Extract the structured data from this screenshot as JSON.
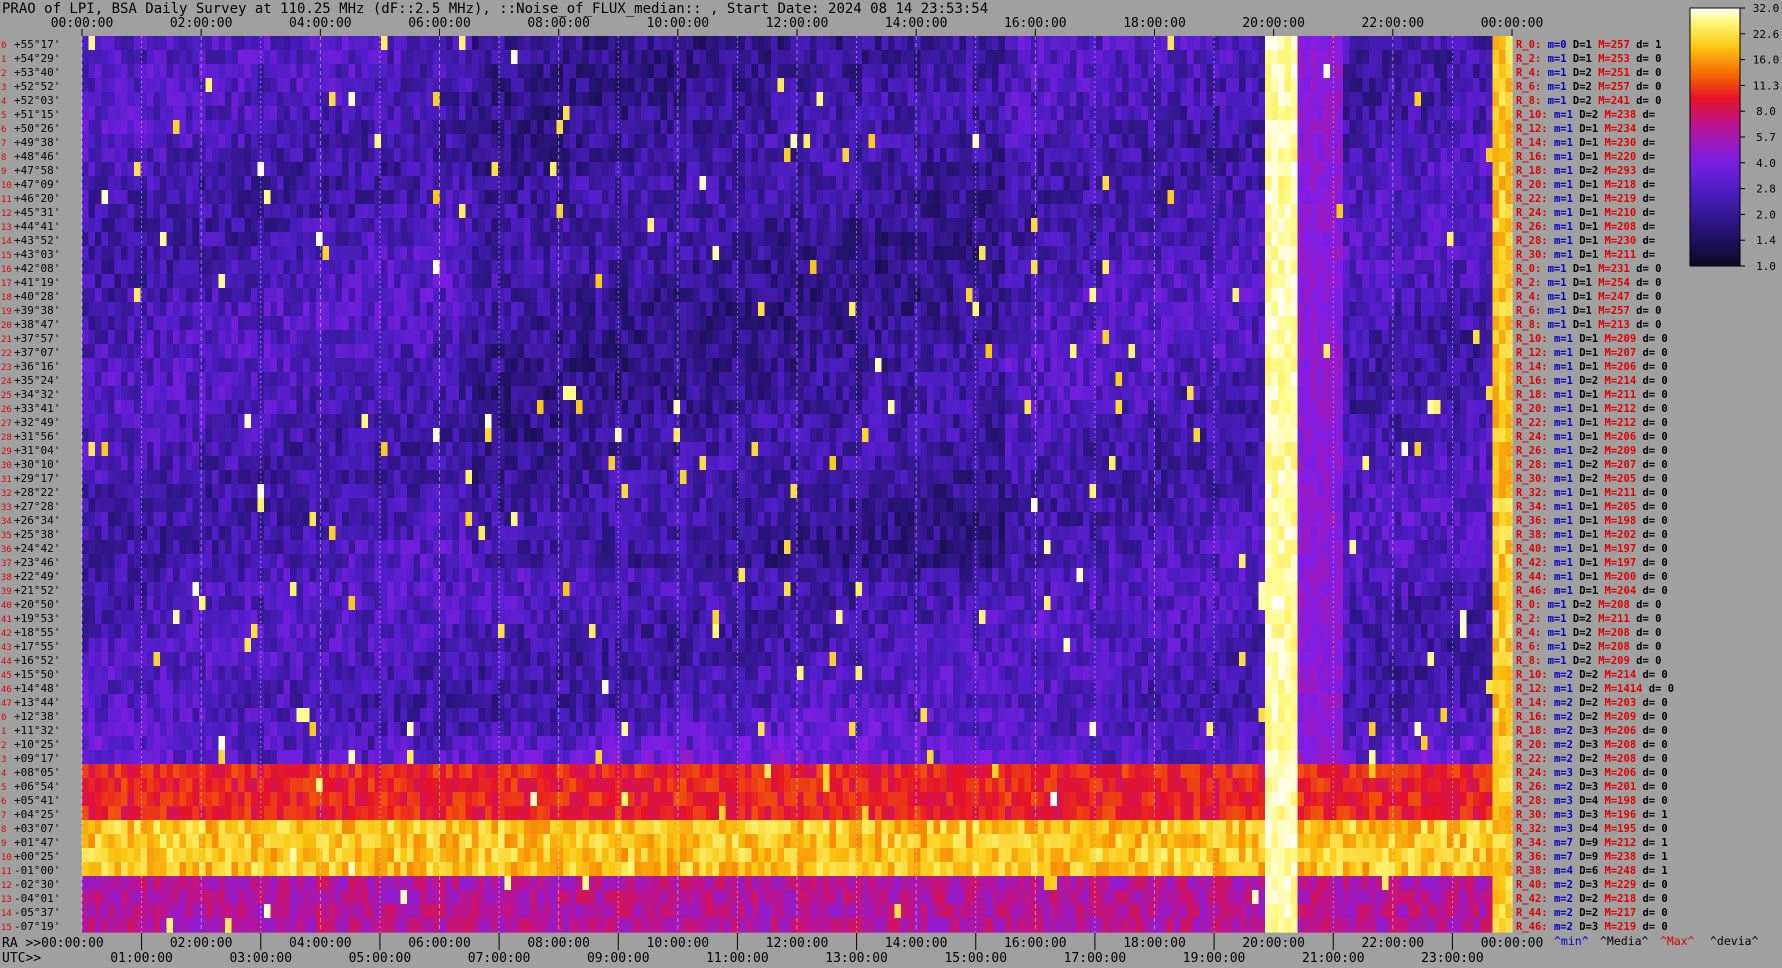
{
  "title": "PRAO of LPI, BSA Daily Survey at 110.25 MHz (dF::2.5 MHz), ::Noise_of_FLUX_median:: , Start Date: 2024 08 14 23:53:54",
  "chart_data": {
    "type": "heatmap",
    "title": "PRAO of LPI, BSA Daily Survey at 110.25 MHz (dF::2.5 MHz), ::Noise_of_FLUX_median:: , Start Date: 2024 08 14 23:53:54",
    "top_axis_ticks": [
      "00:00:00",
      "02:00:00",
      "04:00:00",
      "06:00:00",
      "08:00:00",
      "10:00:00",
      "12:00:00",
      "14:00:00",
      "16:00:00",
      "18:00:00",
      "20:00:00",
      "22:00:00",
      "00:00:00"
    ],
    "bottom_axis_label": "UTC>>",
    "ra_axis_label": "RA >>00:00:00",
    "bottom_axis_ticks": [
      "01:00:00",
      "03:00:00",
      "05:00:00",
      "07:00:00",
      "09:00:00",
      "11:00:00",
      "13:00:00",
      "15:00:00",
      "17:00:00",
      "19:00:00",
      "21:00:00",
      "23:00:00"
    ],
    "bottom_axis_ticks_upper": [
      "02:00:00",
      "04:00:00",
      "06:00:00",
      "08:00:00",
      "10:00:00",
      "12:00:00",
      "14:00:00",
      "16:00:00",
      "18:00:00",
      "20:00:00",
      "22:00:00",
      "00:00:00"
    ],
    "declinations": [
      "+55°17'",
      "+54°29'",
      "+53°40'",
      "+52°52'",
      "+52°03'",
      "+51°15'",
      "+50°26'",
      "+49°38'",
      "+48°46'",
      "+47°58'",
      "+47°09'",
      "+46°20'",
      "+45°31'",
      "+44°41'",
      "+43°52'",
      "+43°03'",
      "+42°08'",
      "+41°19'",
      "+40°28'",
      "+39°38'",
      "+38°47'",
      "+37°57'",
      "+37°07'",
      "+36°16'",
      "+35°24'",
      "+34°32'",
      "+33°41'",
      "+32°49'",
      "+31°56'",
      "+31°04'",
      "+30°10'",
      "+29°17'",
      "+28°22'",
      "+27°28'",
      "+26°34'",
      "+25°38'",
      "+24°42'",
      "+23°46'",
      "+22°49'",
      "+21°52'",
      "+20°50'",
      "+19°53'",
      "+18°55'",
      "+17°55'",
      "+16°52'",
      "+15°50'",
      "+14°48'",
      "+13°44'",
      "+12°38'",
      "+11°32'",
      "+10°25'",
      "+09°17'",
      "+08°05'",
      "+06°54'",
      "+05°41'",
      "+04°25'",
      "+03°07'",
      "+01°47'",
      "+00°25'",
      "-01°00'",
      "-02°30'",
      "-04°01'",
      "-05°37'",
      "-07°19'"
    ],
    "colorbar": {
      "ticks": [
        "32.0",
        "22.6",
        "16.0",
        "11.3",
        "8.0",
        "5.7",
        "4.0",
        "2.8",
        "2.0",
        "1.4",
        "1.0"
      ],
      "scale": "log2",
      "range": [
        1.0,
        32.0
      ]
    },
    "right_stats": [
      "R_0: m=0 D=1 M=257 d= 1",
      "R_2: m=1 D=1 M=253 d= 0",
      "R_4: m=1 D=2 M=251 d= 0",
      "R_6: m=1 D=2 M=257 d= 0",
      "R_8: m=1 D=2 M=241 d= 0",
      "R_10: m=1 D=2 M=238 d=",
      "R_12: m=1 D=1 M=234 d=",
      "R_14: m=1 D=1 M=230 d=",
      "R_16: m=1 D=1 M=220 d=",
      "R_18: m=1 D=2 M=293 d=",
      "R_20: m=1 D=1 M=218 d=",
      "R_22: m=1 D=1 M=219 d=",
      "R_24: m=1 D=1 M=210 d=",
      "R_26: m=1 D=1 M=208 d=",
      "R_28: m=1 D=1 M=230 d=",
      "R_30: m=1 D=1 M=211 d=",
      "R_0: m=1 D=1 M=231 d= 0",
      "R_2: m=1 D=1 M=254 d= 0",
      "R_4: m=1 D=1 M=247 d= 0",
      "R_6: m=1 D=1 M=257 d= 0",
      "R_8: m=1 D=1 M=213 d= 0",
      "R_10: m=1 D=1 M=209 d= 0",
      "R_12: m=1 D=1 M=207 d= 0",
      "R_14: m=1 D=1 M=206 d= 0",
      "R_16: m=1 D=2 M=214 d= 0",
      "R_18: m=1 D=1 M=211 d= 0",
      "R_20: m=1 D=1 M=212 d= 0",
      "R_22: m=1 D=1 M=212 d= 0",
      "R_24: m=1 D=1 M=206 d= 0",
      "R_26: m=1 D=2 M=209 d= 0",
      "R_28: m=1 D=2 M=207 d= 0",
      "R_30: m=1 D=2 M=205 d= 0",
      "R_32: m=1 D=1 M=211 d= 0",
      "R_34: m=1 D=1 M=205 d= 0",
      "R_36: m=1 D=1 M=198 d= 0",
      "R_38: m=1 D=1 M=202 d= 0",
      "R_40: m=1 D=1 M=197 d= 0",
      "R_42: m=1 D=1 M=197 d= 0",
      "R_44: m=1 D=1 M=200 d= 0",
      "R_46: m=1 D=1 M=204 d= 0",
      "R_0: m=1 D=2 M=208 d= 0",
      "R_2: m=1 D=2 M=211 d= 0",
      "R_4: m=1 D=2 M=208 d= 0",
      "R_6: m=1 D=2 M=208 d= 0",
      "R_8: m=1 D=2 M=209 d= 0",
      "R_10: m=2 D=2 M=214 d= 0",
      "R_12: m=1 D=2 M=1414 d= 0",
      "R_14: m=2 D=2 M=203 d= 0",
      "R_16: m=2 D=2 M=209 d= 0",
      "R_18: m=2 D=3 M=206 d= 0",
      "R_20: m=2 D=3 M=208 d= 0",
      "R_22: m=2 D=2 M=208 d= 0",
      "R_24: m=3 D=3 M=206 d= 0",
      "R_26: m=2 D=3 M=201 d= 0",
      "R_28: m=3 D=4 M=198 d= 0",
      "R_30: m=3 D=3 M=196 d= 1",
      "R_32: m=3 D=4 M=195 d= 0",
      "R_34: m=7 D=9 M=212 d= 1",
      "R_36: m=7 D=9 M=238 d= 1",
      "R_38: m=4 D=6 M=248 d= 1",
      "R_40: m=2 D=3 M=229 d= 0",
      "R_42: m=2 D=2 M=218 d= 0",
      "R_44: m=2 D=2 M=217 d= 0",
      "R_46: m=2 D=3 M=219 d= 0"
    ],
    "stats_legend": [
      "^min^",
      "^Media^",
      "^Max^",
      "^devia^"
    ],
    "legend_colors": {
      "min": "#0000c0",
      "media": "#000000",
      "max": "#e00000",
      "devia": "#000000"
    },
    "features": [
      {
        "name": "bright interference band",
        "time_range": [
          "19:55:00",
          "20:20:00"
        ],
        "level": "max"
      },
      {
        "name": "bright interference band",
        "time_range": [
          "23:40:00",
          "23:55:00"
        ],
        "level": "max"
      },
      {
        "name": "galactic plane band",
        "dec_range": [
          "+03°07'",
          "-01°00'"
        ],
        "level": "high"
      }
    ]
  },
  "colors": {
    "background": "#a0a0a0",
    "stat_label": "#e00000",
    "stat_m": "#0000c0",
    "stat_m_text": "#000000"
  }
}
